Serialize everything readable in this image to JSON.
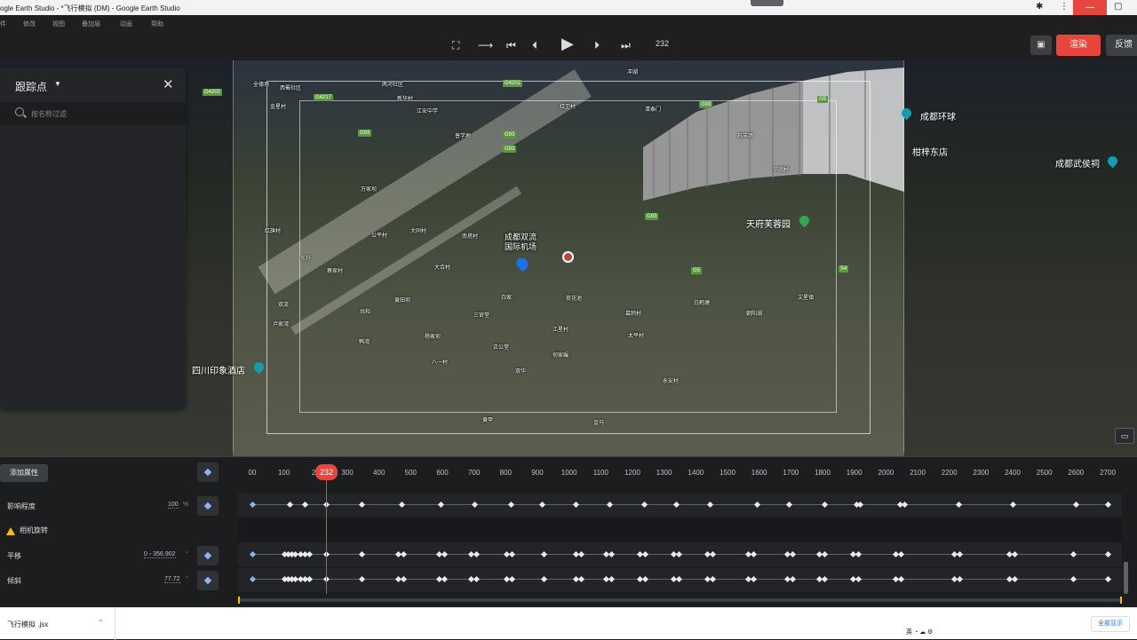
{
  "window": {
    "title": "ogle Earth Studio - *飞行模拟 (DM) - Google Earth Studio"
  },
  "menu": [
    "件",
    "修改",
    "视图",
    "叠加层",
    "动画",
    "帮助"
  ],
  "toolbar": {
    "frame_number": "232",
    "render_label": "渲染",
    "feedback_label": "反馈",
    "icons": [
      "fullscreen-icon",
      "arrow-right-icon",
      "skip-start-icon",
      "step-back-icon",
      "play-icon",
      "step-forward-icon",
      "skip-end-icon",
      "image-icon"
    ]
  },
  "tracking_panel": {
    "title": "跟踪点",
    "search_placeholder": "按名称过滤"
  },
  "map": {
    "airport_label_line1": "成都双流",
    "airport_label_line2": "国际机场",
    "poi_tianfu": "天府芙蓉园",
    "poi_right1": "成都环球",
    "poi_right2": "柑梓东店",
    "poi_right3": "成都武侯祠",
    "poi_left": "四川印象酒店",
    "road_signs": [
      "G4202",
      "G4217",
      "G93",
      "G93",
      "G93",
      "G5",
      "S4",
      "G93",
      "G5",
      "G4202",
      "G93"
    ],
    "place_labels": [
      "全德场",
      "西蜀社区",
      "金星村",
      "两河社区",
      "新华村",
      "江安中学",
      "普学地",
      "红卫村",
      "冲湖",
      "清泰门",
      "石羊场",
      "华润村",
      "万家坝",
      "公平村",
      "大同村",
      "南塔村",
      "红旗村",
      "东升",
      "蔡家村",
      "大合村",
      "白家",
      "黄田坝",
      "共和",
      "双流",
      "三官堂",
      "鸭湾",
      "卢家湾",
      "杨家坝",
      "八一村",
      "正公堂",
      "江星村",
      "荷花池",
      "葛陌村",
      "白鹤塘",
      "文星镇",
      "何家碾",
      "太平村",
      "朝阳湖",
      "双华",
      "永安村",
      "黄甲",
      "金马"
    ]
  },
  "timeline": {
    "add_property_label": "添加属性",
    "current_frame": "232",
    "ticks": [
      "00",
      "100",
      "20",
      "300",
      "400",
      "500",
      "600",
      "700",
      "800",
      "900",
      "1000",
      "1100",
      "1200",
      "1300",
      "1400",
      "1500",
      "1600",
      "1700",
      "1800",
      "1900",
      "2000",
      "2100",
      "2200",
      "2300",
      "2400",
      "2500",
      "2600",
      "2700"
    ],
    "properties": [
      {
        "name": "影响程度",
        "value": "100",
        "unit": "%"
      },
      {
        "name": "相机旋转",
        "value": "",
        "unit": ""
      },
      {
        "name": "平移",
        "value": "0 ◦ 356.902",
        "unit": "°"
      },
      {
        "name": "倾斜",
        "value": "77.72",
        "unit": "°"
      }
    ]
  },
  "downloads": {
    "file_name": "飞行模拟 .jsx",
    "show_all_label": "全部显示",
    "ime_text": "英 ◔ ☁ ⚙"
  },
  "colors": {
    "accent_red": "#e8453c",
    "keyframe_blue": "#8ab4f8",
    "warning_yellow": "#fbbc04"
  }
}
